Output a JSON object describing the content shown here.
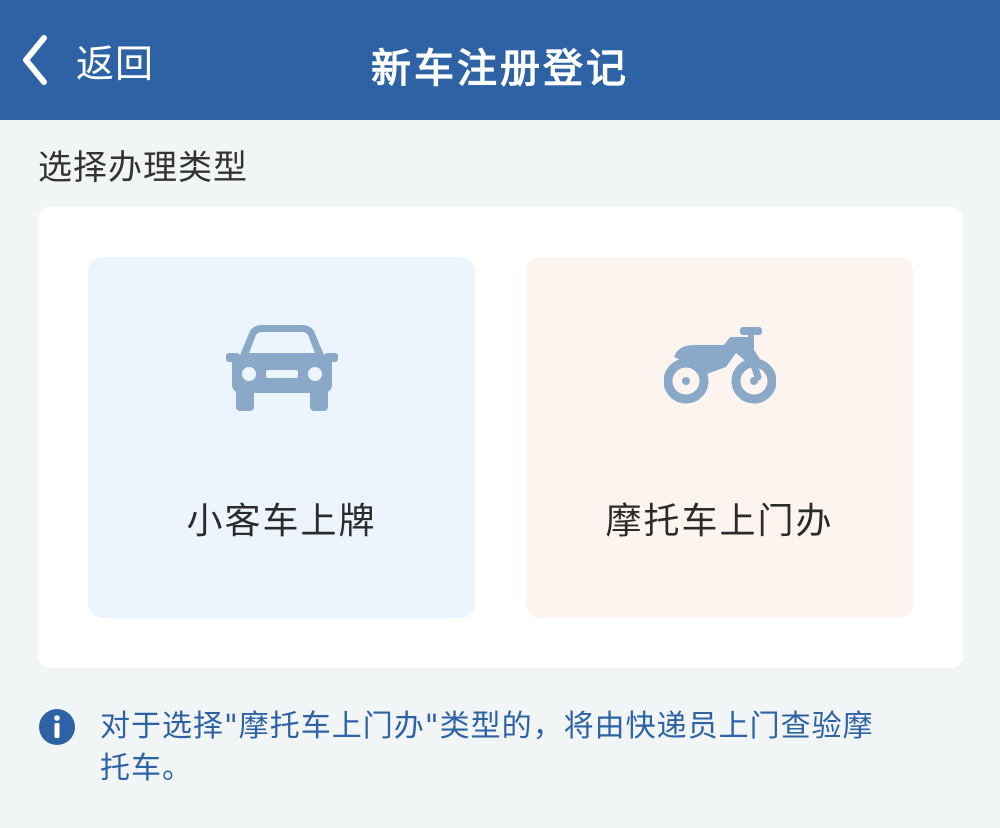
{
  "header": {
    "back_label": "返回",
    "title": "新车注册登记",
    "background_color": "#2d63a5"
  },
  "section": {
    "label": "选择办理类型"
  },
  "options": [
    {
      "label": "小客车上牌",
      "icon": "car-icon",
      "background_color": "#ecf5fd",
      "icon_color": "#8aa9c8"
    },
    {
      "label": "摩托车上门办",
      "icon": "motorcycle-icon",
      "background_color": "#fdf4ef",
      "icon_color": "#8aa9c8"
    }
  ],
  "notice": {
    "icon": "info-icon",
    "text": "对于选择\"摩托车上门办\"类型的，将由快递员上门查验摩托车。",
    "color": "#2d63a5"
  }
}
